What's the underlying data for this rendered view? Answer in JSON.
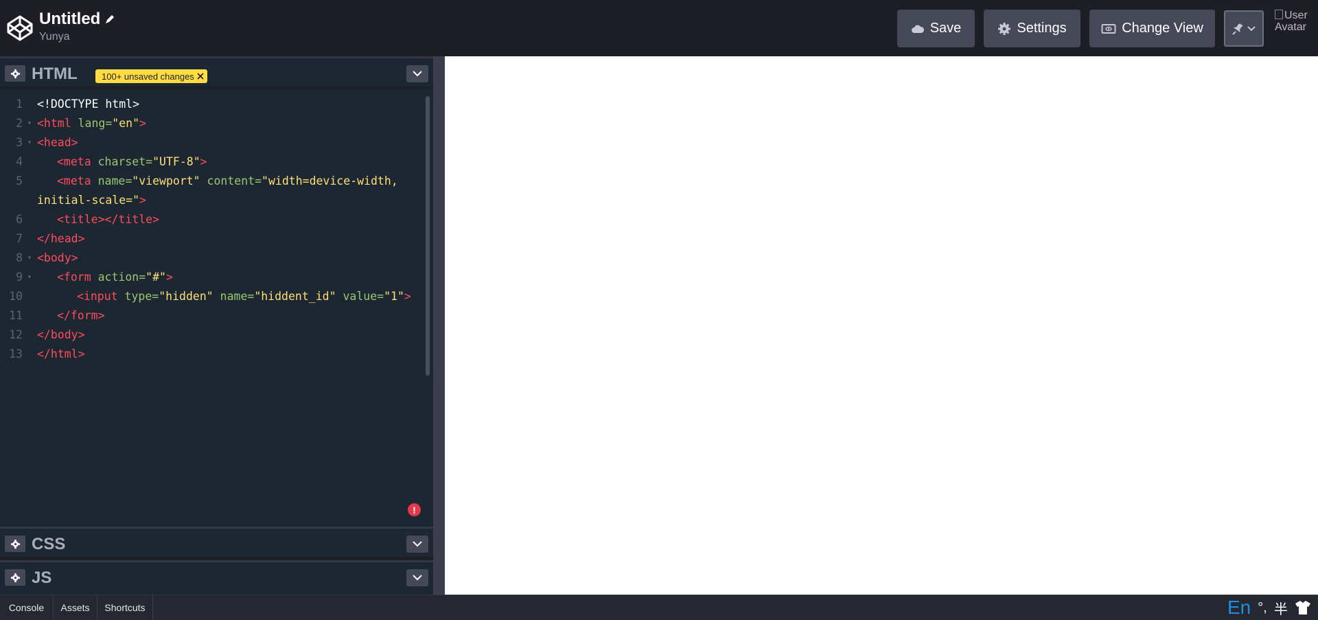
{
  "header": {
    "title": "Untitled",
    "author": "Yunya",
    "buttons": {
      "save": "Save",
      "settings": "Settings",
      "change_view": "Change View"
    },
    "avatar_alt": "User Avatar"
  },
  "editors": {
    "html": {
      "title": "HTML",
      "badge": "100+ unsaved changes"
    },
    "css": {
      "title": "CSS"
    },
    "js": {
      "title": "JS"
    }
  },
  "code_lines": [
    {
      "n": "1",
      "fold": false,
      "indent": 0,
      "parts": [
        [
          "plain",
          "<!DOCTYPE html>"
        ]
      ]
    },
    {
      "n": "2",
      "fold": true,
      "indent": 0,
      "parts": [
        [
          "tag",
          "<html "
        ],
        [
          "attr",
          "lang="
        ],
        [
          "str",
          "\"en\""
        ],
        [
          "tag",
          ">"
        ]
      ]
    },
    {
      "n": "3",
      "fold": true,
      "indent": 0,
      "parts": [
        [
          "tag",
          "<head>"
        ]
      ]
    },
    {
      "n": "4",
      "fold": false,
      "indent": 1,
      "parts": [
        [
          "tag",
          "<meta "
        ],
        [
          "attr",
          "charset="
        ],
        [
          "str",
          "\"UTF-8\""
        ],
        [
          "tag",
          ">"
        ]
      ]
    },
    {
      "n": "5",
      "fold": false,
      "indent": 1,
      "parts": [
        [
          "tag",
          "<meta "
        ],
        [
          "attr",
          "name="
        ],
        [
          "str",
          "\"viewport\""
        ],
        [
          "attr",
          " content="
        ],
        [
          "str",
          "\"width=device-width,"
        ]
      ]
    },
    {
      "n": "",
      "fold": false,
      "indent": 0,
      "parts": [
        [
          "str",
          "initial-scale=\""
        ],
        [
          "tag",
          ">"
        ]
      ]
    },
    {
      "n": "6",
      "fold": false,
      "indent": 1,
      "parts": [
        [
          "tag",
          "<title></title>"
        ]
      ]
    },
    {
      "n": "7",
      "fold": false,
      "indent": 0,
      "parts": [
        [
          "tag",
          "</head>"
        ]
      ]
    },
    {
      "n": "8",
      "fold": true,
      "indent": 0,
      "parts": [
        [
          "tag",
          "<body>"
        ]
      ]
    },
    {
      "n": "9",
      "fold": true,
      "indent": 1,
      "parts": [
        [
          "tag",
          "<form "
        ],
        [
          "attr",
          "action="
        ],
        [
          "str",
          "\"#\""
        ],
        [
          "tag",
          ">"
        ]
      ]
    },
    {
      "n": "10",
      "fold": false,
      "indent": 2,
      "parts": [
        [
          "tag",
          "<input "
        ],
        [
          "attr",
          "type="
        ],
        [
          "str",
          "\"hidden\""
        ],
        [
          "attr",
          " name="
        ],
        [
          "str",
          "\"hiddent_id\""
        ],
        [
          "attr",
          " value="
        ],
        [
          "str",
          "\"1\""
        ],
        [
          "tag",
          ">"
        ]
      ]
    },
    {
      "n": "11",
      "fold": false,
      "indent": 1,
      "parts": [
        [
          "tag",
          "</form>"
        ]
      ]
    },
    {
      "n": "12",
      "fold": false,
      "indent": 0,
      "parts": [
        [
          "tag",
          "</body>"
        ]
      ]
    },
    {
      "n": "13",
      "fold": false,
      "indent": 0,
      "parts": [
        [
          "tag",
          "</html>"
        ]
      ]
    }
  ],
  "footer": {
    "tabs": [
      "Console",
      "Assets",
      "Shortcuts"
    ],
    "ime": {
      "lang": "En",
      "punct": "°,",
      "width": "半"
    }
  },
  "error_indicator": "!",
  "colors": {
    "header_bg": "#1e1f26",
    "editor_bg": "#1d2731",
    "button_bg": "#444857",
    "badge_bg": "#ffdd40",
    "tag": "#ff4b5f",
    "attr": "#99c775",
    "string": "#ffdf7a",
    "error": "#e23a4c",
    "ime_blue": "#1d8fe5"
  }
}
